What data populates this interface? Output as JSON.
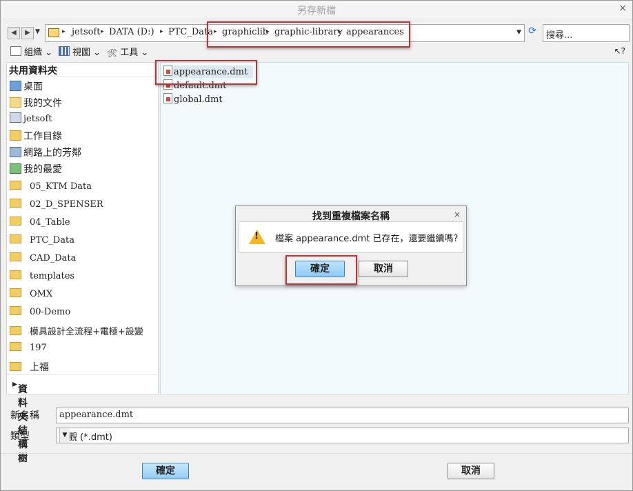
{
  "window": {
    "title": "另存新檔",
    "close": "×"
  },
  "nav": {
    "back": "◀",
    "forward": "▶",
    "history": "▼",
    "breadcrumbs": [
      "jetsoft",
      "DATA (D:)",
      "PTC_Data",
      "graphiclib",
      "graphic-library",
      "appearances"
    ],
    "address_dropdown": "▼",
    "refresh": "⟳",
    "search_placeholder": "搜尋..."
  },
  "toolbar": {
    "organize": "組織 ⌄",
    "view": "視圖 ⌄",
    "tools": "工具 ⌄",
    "help": "?"
  },
  "sidebar": {
    "header": "共用資料夾",
    "special_items": [
      {
        "label": "桌面",
        "icon": "desktop-icon"
      },
      {
        "label": "我的文件",
        "icon": "documents-icon"
      },
      {
        "label": "jetsoft",
        "icon": "computer-icon"
      },
      {
        "label": "工作目錄",
        "icon": "working-directory-icon"
      },
      {
        "label": "網路上的芳鄰",
        "icon": "network-icon"
      },
      {
        "label": "我的最愛",
        "icon": "favorites-icon"
      }
    ],
    "folders": [
      "05_KTM Data",
      "02_D_SPENSER",
      "04_Table",
      "PTC_Data",
      "CAD_Data",
      "templates",
      "OMX",
      "00-Demo",
      "模具設計全流程+電極+設變",
      "197",
      "上福"
    ],
    "tree_label": "資料夾結構樹"
  },
  "files": [
    "appearance.dmt",
    "default.dmt",
    "global.dmt"
  ],
  "dialog": {
    "title": "找到重複檔案名稱",
    "close": "×",
    "message": "檔案 appearance.dmt 已存在，還要繼續嗎?",
    "ok": "確定",
    "cancel": "取消"
  },
  "form": {
    "name_label": "新名稱",
    "name_value": "appearance.dmt",
    "type_label": "類型",
    "type_value": "外觀 (*.dmt)"
  },
  "buttons": {
    "ok": "確定",
    "cancel": "取消"
  }
}
